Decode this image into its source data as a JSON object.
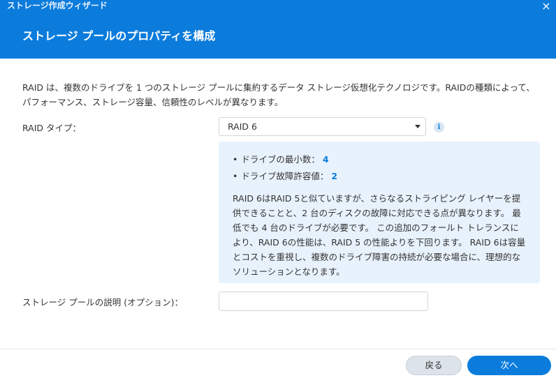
{
  "window": {
    "title": "ストレージ作成ウィザード",
    "close_glyph": "×"
  },
  "page": {
    "title": "ストレージ プールのプロパティを構成"
  },
  "description": "RAID は、複数のドライブを 1 つのストレージ プールに集約するデータ ストレージ仮想化テクノロジです。RAIDの種類によって、パフォーマンス、ストレージ容量、信頼性のレベルが異なります。",
  "raid_type": {
    "label": "RAID タイプ：",
    "selected": "RAID 6",
    "info_glyph": "i"
  },
  "info": {
    "min_drives_label": "ドライブの最小数：",
    "min_drives_value": "4",
    "fault_tolerance_label": "ドライブ故障許容値：",
    "fault_tolerance_value": "2",
    "text": "RAID 6はRAID 5と似ていますが、さらなるストライピング レイヤーを提供できることと、2 台のディスクの故障に対応できる点が異なります。 最低でも 4 台のドライブが必要です。 この追加のフォールト トレランスにより、RAID 6の性能は、RAID 5 の性能よりを下回ります。 RAID 6は容量とコストを重視し、複数のドライブ障害の持続が必要な場合に、理想的なソリューションとなります。"
  },
  "pool_description": {
    "label": "ストレージ プールの説明 (オプション)：",
    "value": "",
    "placeholder": ""
  },
  "footer": {
    "back_label": "戻る",
    "next_label": "次へ"
  },
  "colors": {
    "accent": "#0b7cdc",
    "info_bg": "#e8f2fc"
  }
}
